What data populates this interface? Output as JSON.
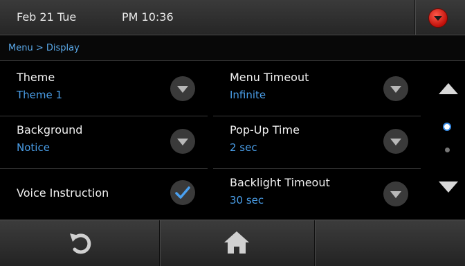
{
  "status_bar": {
    "date": "Feb 21 Tue",
    "time": "PM 10:36"
  },
  "breadcrumb": "Menu > Display",
  "settings": [
    {
      "label": "Theme",
      "value": "Theme 1",
      "control": "dropdown"
    },
    {
      "label": "Background",
      "value": "Notice",
      "control": "dropdown"
    },
    {
      "label": "Voice Instruction",
      "value": "",
      "control": "checkbox",
      "checked": true
    },
    {
      "label": "Menu Timeout",
      "value": "Infinite",
      "control": "dropdown"
    },
    {
      "label": "Pop-Up Time",
      "value": "2 sec",
      "control": "dropdown"
    },
    {
      "label": "Backlight Timeout",
      "value": "30 sec",
      "control": "dropdown"
    }
  ],
  "page_indicator": {
    "current": 1,
    "total": 2
  },
  "icons": {
    "alert": "alert-dropdown-icon",
    "back": "back-refresh-icon",
    "home": "home-icon",
    "up": "scroll-up-icon",
    "down": "scroll-down-icon"
  },
  "colors": {
    "accent": "#4a9ee8",
    "alert": "#d0140c",
    "check": "#4aa0f0"
  }
}
